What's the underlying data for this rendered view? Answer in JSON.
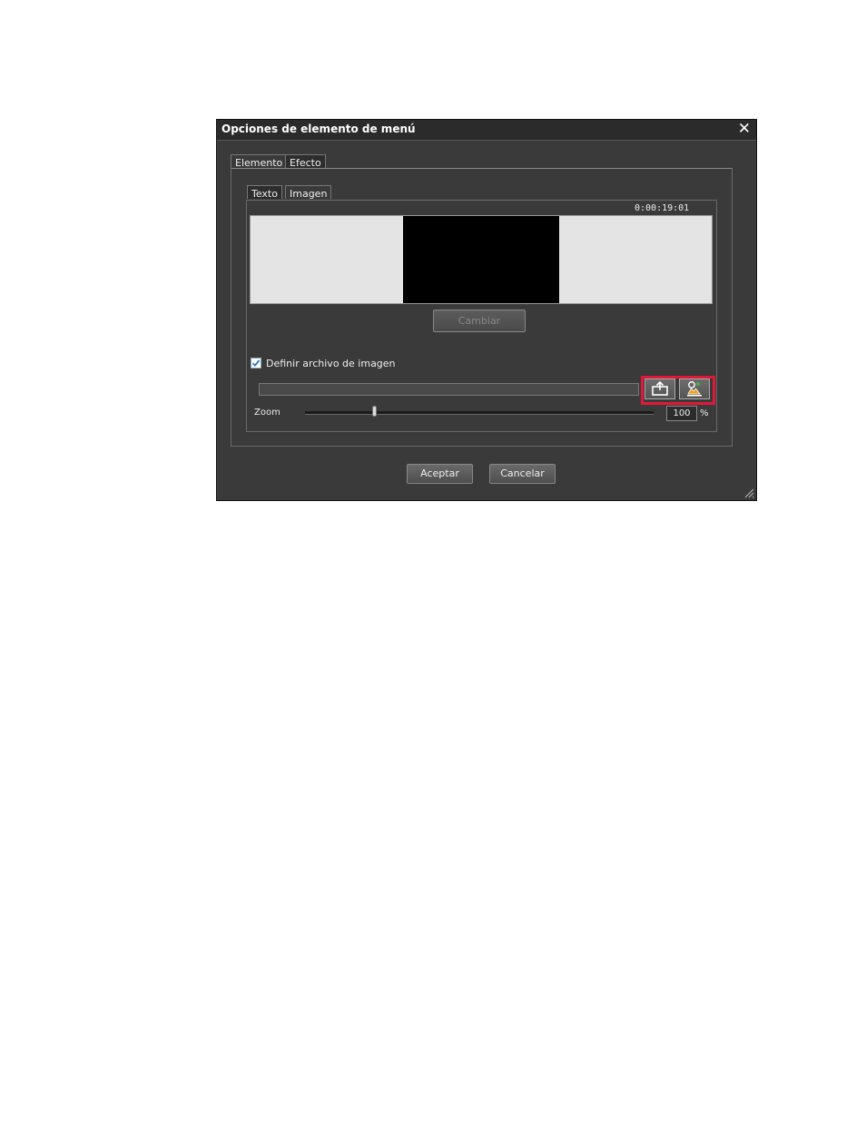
{
  "dialog": {
    "title": "Opciones de elemento de menú",
    "close_glyph": "✕"
  },
  "outer_tabs": [
    {
      "label": "Elemento",
      "active": true
    },
    {
      "label": "Efecto",
      "active": false
    }
  ],
  "inner_tabs": [
    {
      "label": "Texto",
      "active": false
    },
    {
      "label": "Imagen",
      "active": true
    }
  ],
  "preview": {
    "timecode": "0:00:19:01"
  },
  "change_button": {
    "label": "Cambiar",
    "enabled": false
  },
  "image_file": {
    "checkbox_label": "Definir archivo de imagen",
    "checked": true,
    "path": ""
  },
  "file_buttons": [
    {
      "icon": "open-folder-icon"
    },
    {
      "icon": "image-settings-icon"
    }
  ],
  "zoom": {
    "label": "Zoom",
    "value": "100",
    "unit": "%",
    "slider_level": 0.2
  },
  "footer": {
    "ok_label": "Aceptar",
    "cancel_label": "Cancelar"
  },
  "colors": {
    "highlight": "#e0193a",
    "checkbox_check": "#2f74d0"
  }
}
